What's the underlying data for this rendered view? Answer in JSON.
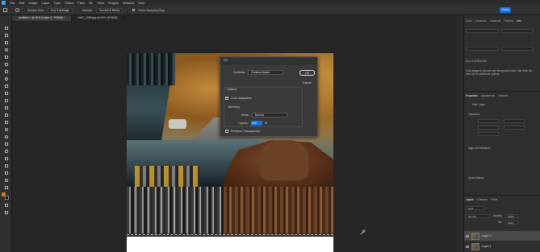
{
  "menu": {
    "items": [
      "File",
      "Edit",
      "Image",
      "Layer",
      "Type",
      "Select",
      "Filter",
      "3D",
      "View",
      "Plugins",
      "Window",
      "Help"
    ]
  },
  "options_bar": {
    "sample_size_label": "Sample Size:",
    "sample_size_value": "3 by 3 Average",
    "sample_label": "Sample:",
    "sample_value": "Current & Below",
    "show_sampling_ring": "Show Sampling Ring",
    "share_label": "Share"
  },
  "tabs": [
    {
      "label": "Untitled-1 @ 50% (Layer 2, RGB/8) *",
      "active": true
    },
    {
      "label": "IMG_4389.jpg @ 50% (RGB/8)",
      "active": false
    }
  ],
  "fill_dialog": {
    "title": "Fill",
    "contents_label": "Contents:",
    "contents_value": "Content-Aware",
    "ok_label": "OK",
    "cancel_label": "Cancel",
    "options_label": "Options",
    "color_adaptation_label": "Color Adaptation",
    "color_adaptation_checked": true,
    "blending_label": "Blending",
    "mode_label": "Mode:",
    "mode_value": "Normal",
    "opacity_label": "Opacity:",
    "opacity_value": "100",
    "opacity_unit": "%",
    "preserve_transparency_label": "Preserve Transparency",
    "preserve_transparency_checked": false
  },
  "right_panel": {
    "top_tabs": [
      "Color",
      "Swatches",
      "Gradients",
      "Patterns",
      "Info"
    ],
    "info_text_1": "Doc: 6.57M/14.3M",
    "info_text_2": "Click image to choose new foreground color. Use Shift, Alt, and Ctrl for additional options.",
    "props_tabs": [
      "Properties",
      "Adjustments",
      "Libraries"
    ],
    "pixel_layer_label": "Pixel Layer",
    "transform_label": "Transform",
    "align_label": "Align and Distribute",
    "quick_actions_label": "Quick Actions",
    "layers_tabs": [
      "Layers",
      "Channels",
      "Paths"
    ],
    "kind_label": "Kind",
    "blend_mode": "Normal",
    "opacity_label": "Opacity:",
    "opacity_value": "100%",
    "fill_label": "Fill:",
    "fill_value": "100%",
    "layers": [
      {
        "name": "Layer 2",
        "selected": true
      },
      {
        "name": "Layer 1",
        "selected": false
      }
    ]
  },
  "colors": {
    "foreground": "#e06a20",
    "background": "#000000",
    "accent": "#1473e6"
  }
}
